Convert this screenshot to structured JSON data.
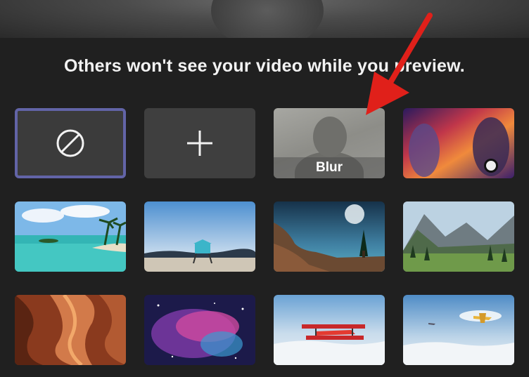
{
  "notice": {
    "text": "Others won't see your video while you preview."
  },
  "options": [
    {
      "id": "none",
      "icon": "no-entry-icon"
    },
    {
      "id": "add",
      "icon": "plus-icon"
    },
    {
      "id": "blur",
      "label": "Blur"
    },
    {
      "id": "space-jam",
      "image": "space-jam-background"
    },
    {
      "id": "tropical-beach",
      "image": "tropical-beach-background"
    },
    {
      "id": "lifeguard-beach",
      "image": "lifeguard-beach-background"
    },
    {
      "id": "alien-planet",
      "image": "alien-planet-background"
    },
    {
      "id": "mountain-valley",
      "image": "mountain-valley-background"
    },
    {
      "id": "slot-canyon",
      "image": "slot-canyon-background"
    },
    {
      "id": "galaxy",
      "image": "galaxy-background"
    },
    {
      "id": "biplane",
      "image": "biplane-background"
    },
    {
      "id": "snowy-plane",
      "image": "snowy-plane-background"
    }
  ],
  "selected": "none",
  "colors": {
    "selection": "#6264a7",
    "annotation_arrow": "#e0201a"
  }
}
